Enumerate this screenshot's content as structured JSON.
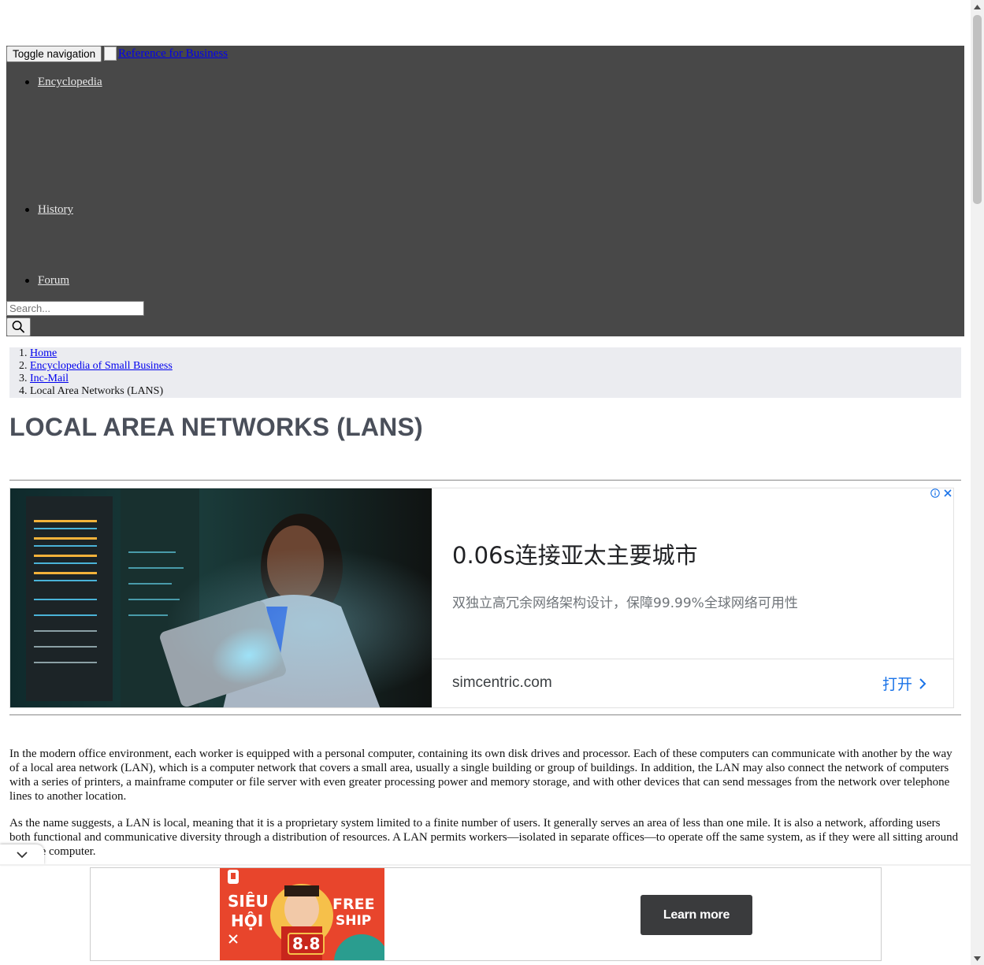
{
  "navbar": {
    "toggle_label": "Toggle navigation",
    "brand_alt": "Reference for Business",
    "items": [
      {
        "label": "Encyclopedia"
      },
      {
        "label": "History"
      },
      {
        "label": "Forum"
      }
    ],
    "search_placeholder": "Search..."
  },
  "breadcrumb": {
    "items": [
      {
        "num": "1.",
        "label": "Home"
      },
      {
        "num": "2.",
        "label": "Encyclopedia of Small Business"
      },
      {
        "num": "3.",
        "label": "Inc-Mail"
      },
      {
        "num": "4.",
        "label": "Local Area Networks (LANS)"
      }
    ]
  },
  "page_title": "LOCAL AREA NETWORKS (LANS)",
  "ad": {
    "headline": "0.06s连接亚太主要城市",
    "subtext": "双独立高冗余网络架构设计，保障99.99%全球网络可用性",
    "domain": "simcentric.com",
    "open_label": "打开",
    "info_icon": "info-icon",
    "close_icon": "close-icon"
  },
  "article": {
    "paragraphs": [
      "In the modern office environment, each worker is equipped with a personal computer, containing its own disk drives and processor. Each of these computers can communicate with another by the way of a local area network (LAN), which is a computer network that covers a small area, usually a single building or group of buildings. In addition, the LAN may also connect the network of computers with a series of printers, a mainframe computer or file server with even greater processing power and memory storage, and with other devices that can send messages from the network over telephone lines to another location.",
      "As the name suggests, a LAN is local, meaning that it is a proprietary system limited to a finite number of users. It generally serves an area of less than one mile. It is also a network, affording users both functional and communicative diversity through a distribution of resources. A LAN permits workers—isolated in separate offices—to operate off the same system, as if they were all sitting around a single computer."
    ]
  },
  "bottom_ad": {
    "button_label": "Learn more",
    "badge_top_left": "SIÊU",
    "badge_bottom_left": "HỘI",
    "badge_top_right": "FREE",
    "badge_bottom_right": "SHIP",
    "badge_number": "8.8"
  }
}
